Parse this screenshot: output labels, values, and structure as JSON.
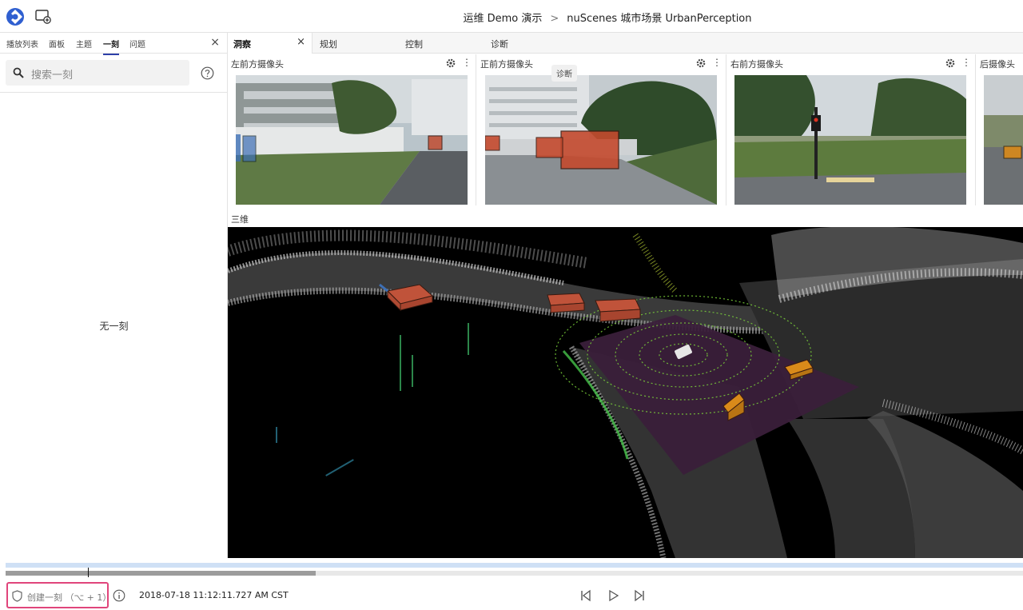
{
  "header": {
    "breadcrumb_root": "运维 Demo 演示",
    "breadcrumb_sep": ">",
    "breadcrumb_current": "nuScenes 城市场景 UrbanPerception"
  },
  "left_panel": {
    "tabs": [
      {
        "label": "播放列表"
      },
      {
        "label": "面板"
      },
      {
        "label": "主题"
      },
      {
        "label": "一刻"
      },
      {
        "label": "问题"
      }
    ],
    "active_tab": "一刻",
    "close_label": "×",
    "search_placeholder": "搜索一刻",
    "empty_message": "无一刻"
  },
  "main_tabs": [
    {
      "label": "洞察"
    },
    {
      "label": "规划"
    },
    {
      "label": "控制"
    },
    {
      "label": "诊断"
    }
  ],
  "tab_close_label": "×",
  "cameras": [
    {
      "title": "左前方摄像头"
    },
    {
      "title": "正前方摄像头"
    },
    {
      "title": "右前方摄像头"
    },
    {
      "title": "后摄像头"
    }
  ],
  "camera_more_label": "⋮",
  "tooltip": "诊断",
  "view3d_title": "三维",
  "footer": {
    "create_moment_label": "创建一刻 （⌥ + 1）",
    "timestamp": "2018-07-18 11:12:11.727 AM CST",
    "timeline_buffer_fraction": 0.305,
    "timeline_cursor_fraction": 0.081
  },
  "colors": {
    "accent": "#2d3fa8",
    "highlight_border": "#e0457b",
    "bbox_red": "#c0533a",
    "bbox_orange": "#d98a1a",
    "lidar_green": "#7bd13a"
  }
}
